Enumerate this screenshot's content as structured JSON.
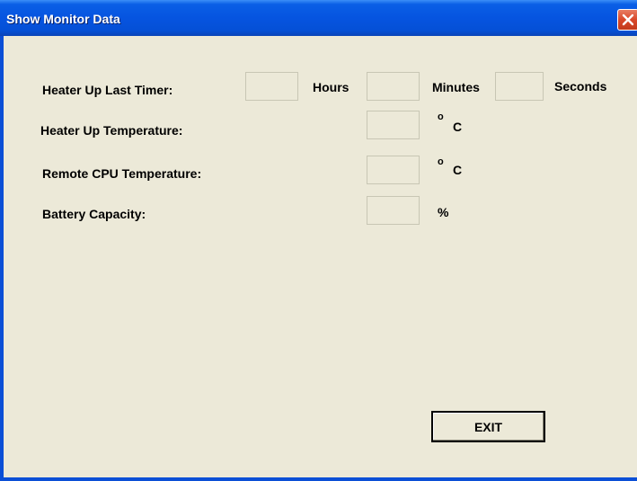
{
  "window": {
    "title": "Show Monitor Data"
  },
  "fields": {
    "heater_timer_label": "Heater Up Last Timer:",
    "hours_label": "Hours",
    "minutes_label": "Minutes",
    "seconds_label": "Seconds",
    "heater_temp_label": "Heater Up Temperature:",
    "cpu_temp_label": "Remote CPU Temperature:",
    "battery_label": "Battery Capacity:",
    "degree_symbol": "o",
    "celsius_unit": "C",
    "percent_unit": "%",
    "hours_value": "",
    "minutes_value": "",
    "seconds_value": "",
    "heater_temp_value": "",
    "cpu_temp_value": "",
    "battery_value": ""
  },
  "buttons": {
    "exit_label": "EXIT"
  },
  "icons": {
    "close": "close-icon"
  },
  "colors": {
    "titlebar": "#0654e0",
    "client_bg": "#ece9d8",
    "close_btn": "#d9482a"
  }
}
